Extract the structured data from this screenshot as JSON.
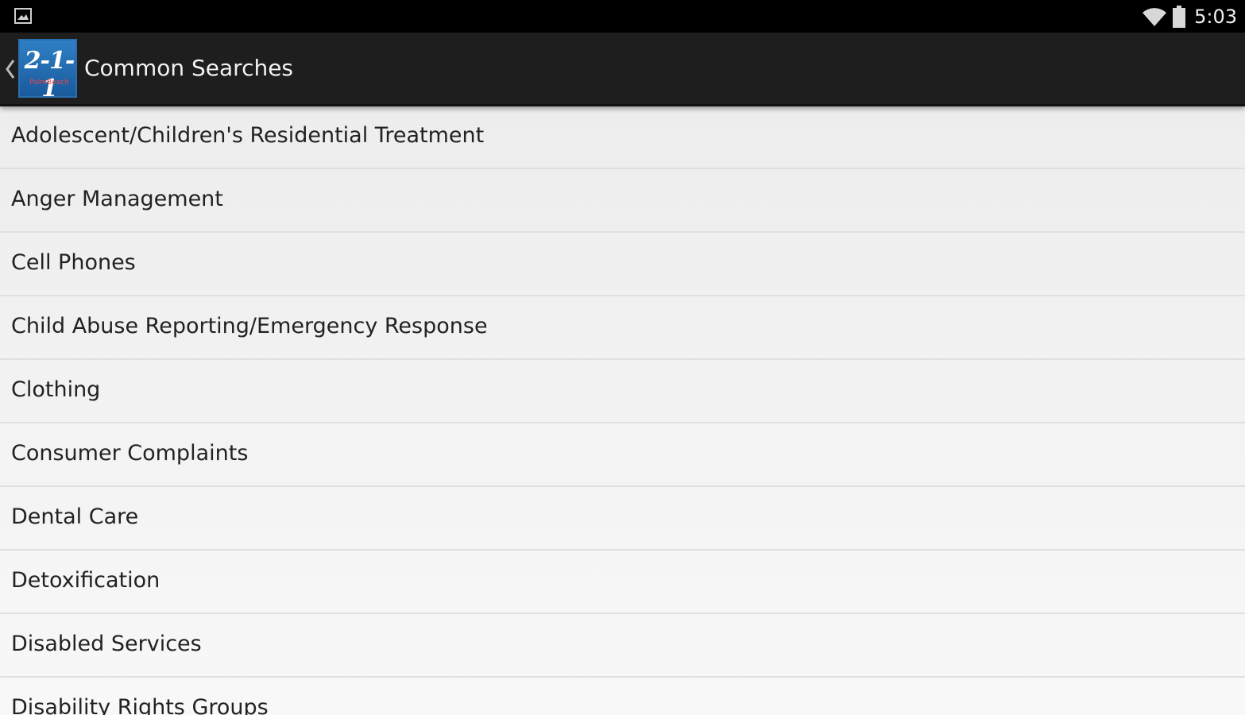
{
  "status_bar": {
    "notification_icon": "image-icon",
    "wifi_icon": "wifi-icon",
    "battery_icon": "battery-icon",
    "time": "5:03"
  },
  "action_bar": {
    "back_icon": "chevron-left-icon",
    "logo_text": "2-1-1",
    "logo_subtext": "PalmBeach",
    "title": "Common Searches",
    "background_color": "#1e1e1e"
  },
  "list": {
    "items": [
      "Adolescent/Children's Residential Treatment",
      "Anger Management",
      "Cell Phones",
      "Child Abuse Reporting/Emergency Response",
      "Clothing",
      "Consumer Complaints",
      "Dental Care",
      "Detoxification",
      "Disabled Services",
      "Disability Rights Groups"
    ]
  }
}
